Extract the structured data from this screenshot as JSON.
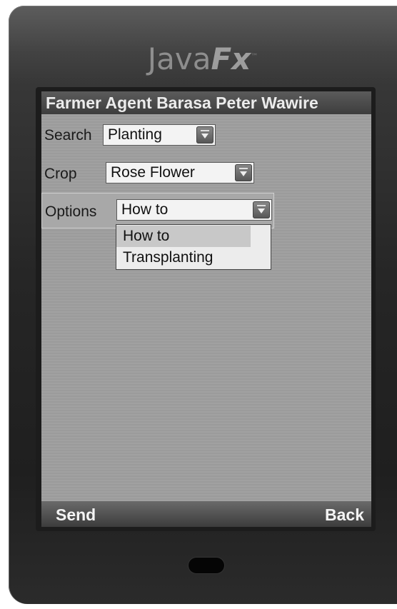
{
  "logo": {
    "java": "Java",
    "fx": "Fx",
    "tm": "™"
  },
  "header": {
    "title": "Farmer Agent Barasa Peter Wawire"
  },
  "form": {
    "search": {
      "label": "Search",
      "value": "Planting"
    },
    "crop": {
      "label": "Crop",
      "value": "Rose Flower"
    },
    "options": {
      "label": "Options",
      "value": "How to",
      "items": [
        {
          "label": "How to",
          "selected": true
        },
        {
          "label": "Transplanting",
          "selected": false
        }
      ]
    }
  },
  "softkeys": {
    "left": "Send",
    "right": "Back"
  }
}
